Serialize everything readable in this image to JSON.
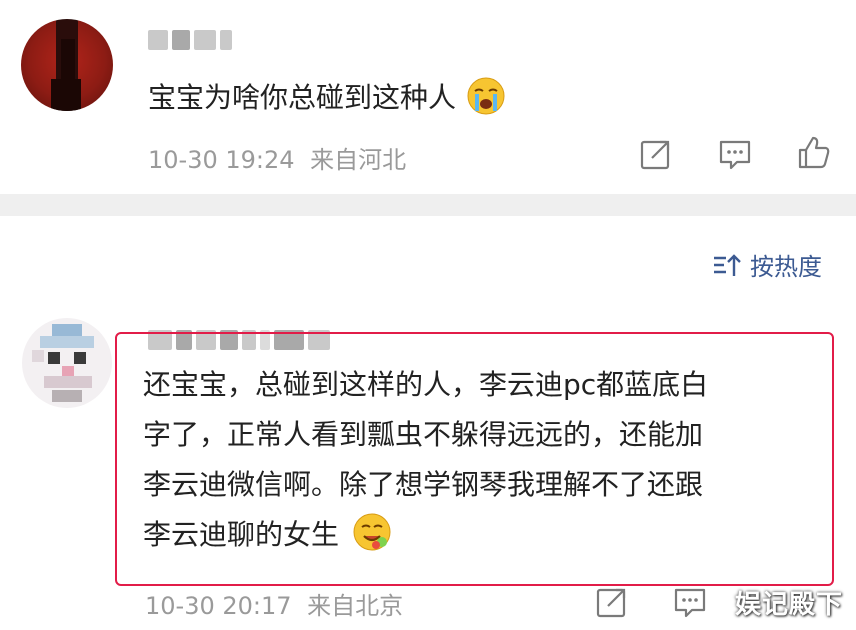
{
  "comment1": {
    "text": "宝宝为啥你总碰到这种人",
    "emoji": "crying-face",
    "time": "10-30 19:24",
    "location": "来自河北"
  },
  "sort": {
    "label": "按热度"
  },
  "comment2": {
    "lines": [
      "还宝宝，总碰到这样的人，李云迪pc都蓝底白",
      "字了，正常人看到瓢虫不躲得远远的，还能加",
      "李云迪微信啊。除了想学钢琴我理解不了还跟",
      "李云迪聊的女生"
    ],
    "emoji": "drooling-face",
    "time": "10-30 20:17",
    "location": "来自北京"
  },
  "watermark": "娱记殿下",
  "colors": {
    "accent": "#3c5a92",
    "highlight": "#e21c48",
    "meta": "#9a9a9a"
  }
}
